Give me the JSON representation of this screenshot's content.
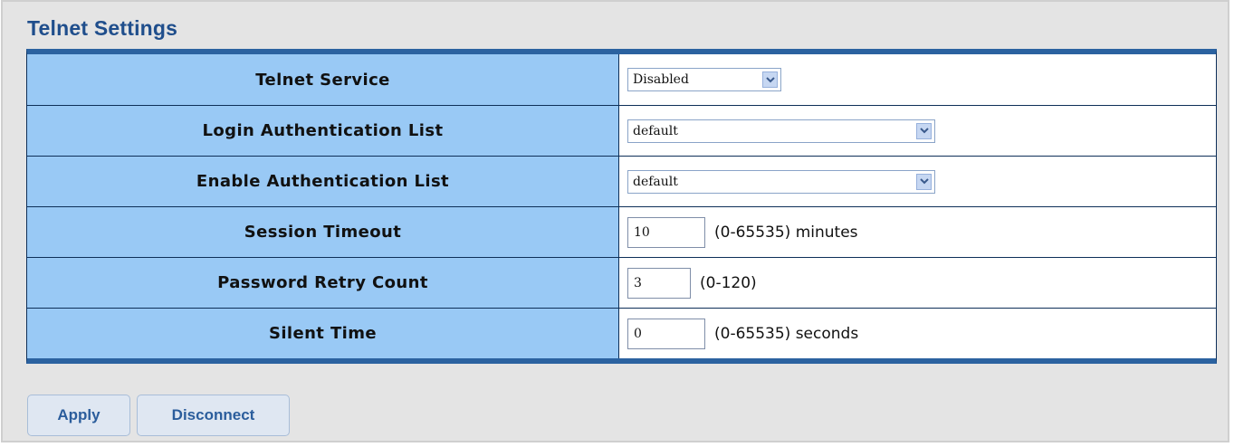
{
  "page": {
    "title": "Telnet Settings"
  },
  "settings": [
    {
      "label": "Telnet Service",
      "type": "select",
      "value": "Disabled"
    },
    {
      "label": "Login Authentication List",
      "type": "select",
      "value": "default"
    },
    {
      "label": "Enable Authentication List",
      "type": "select",
      "value": "default"
    },
    {
      "label": "Session Timeout",
      "type": "input",
      "value": "10",
      "hint": "(0-65535) minutes"
    },
    {
      "label": "Password Retry Count",
      "type": "input",
      "value": "3",
      "hint": "(0-120)"
    },
    {
      "label": "Silent Time",
      "type": "input",
      "value": "0",
      "hint": "(0-65535) seconds"
    }
  ],
  "actions": {
    "apply_label": "Apply",
    "disconnect_label": "Disconnect"
  },
  "colors": {
    "title": "#1f4e8c",
    "label_background": "#99c9f5",
    "table_border": "#2b62a0",
    "button_text": "#2b5d9c"
  }
}
